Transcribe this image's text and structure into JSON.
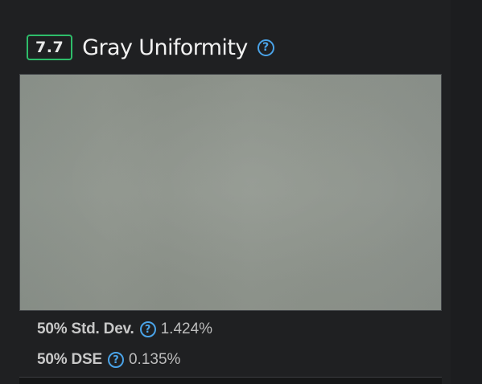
{
  "section": {
    "score": "7.7",
    "title": "Gray Uniformity",
    "help_glyph": "?"
  },
  "metrics": [
    {
      "label": "50% Std. Dev.",
      "value": "1.424%"
    },
    {
      "label": "50% DSE",
      "value": "0.135%"
    }
  ],
  "colors": {
    "background": "#1c1d1f",
    "score_border": "#2ebd6a",
    "help_icon": "#4aa3e8",
    "test_image": "#8d938b"
  },
  "icons": [
    "question-circle-icon"
  ]
}
